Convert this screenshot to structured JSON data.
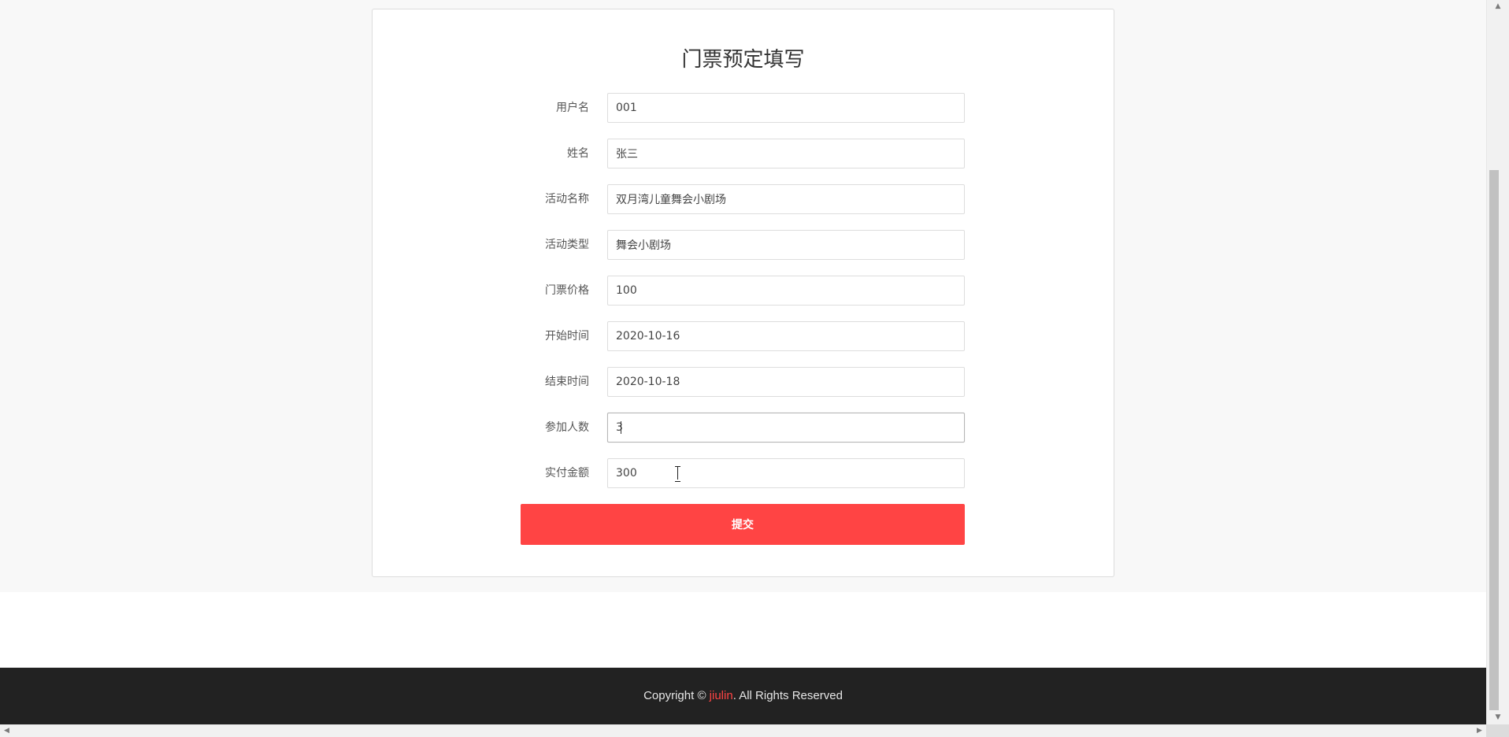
{
  "form": {
    "title": "门票预定填写",
    "fields": [
      {
        "label": "用户名",
        "value": "001"
      },
      {
        "label": "姓名",
        "value": "张三"
      },
      {
        "label": "活动名称",
        "value": "双月湾儿童舞会小剧场"
      },
      {
        "label": "活动类型",
        "value": "舞会小剧场"
      },
      {
        "label": "门票价格",
        "value": "100"
      },
      {
        "label": "开始时间",
        "value": "2020-10-16"
      },
      {
        "label": "结束时间",
        "value": "2020-10-18"
      },
      {
        "label": "参加人数",
        "value": "3"
      },
      {
        "label": "实付金额",
        "value": "300"
      }
    ],
    "submit_label": "提交"
  },
  "footer": {
    "prefix": "Copyright © ",
    "brand": "jiulin",
    "suffix": ". All Rights Reserved"
  },
  "colors": {
    "accent": "#ff4444",
    "footer_bg": "#222222"
  }
}
